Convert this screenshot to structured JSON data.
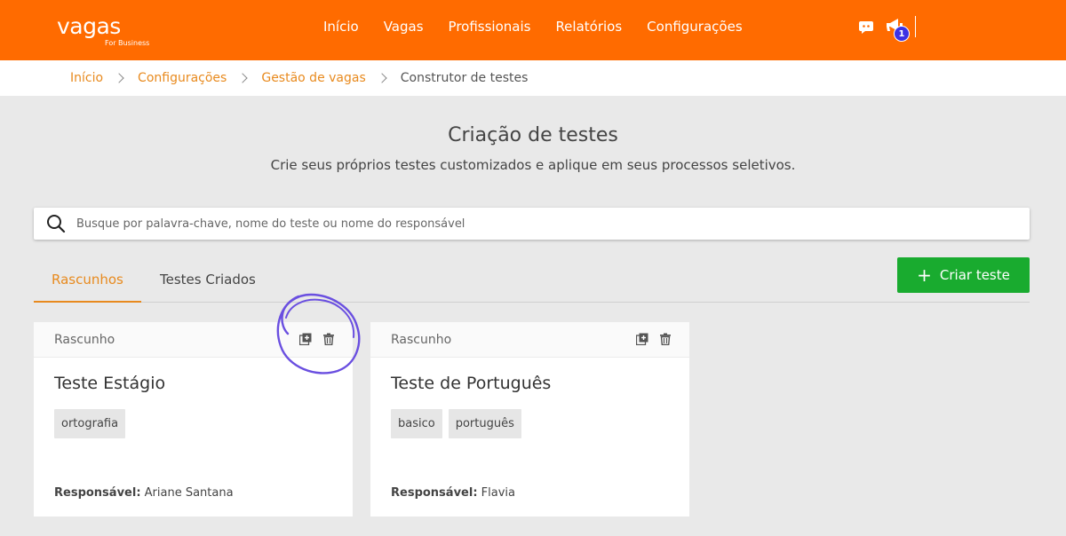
{
  "header": {
    "logo_text": "vagas",
    "logo_sub": "For Business",
    "nav": [
      "Início",
      "Vagas",
      "Profissionais",
      "Relatórios",
      "Configurações"
    ],
    "notification_count": "1",
    "icons": [
      "chat-icon",
      "megaphone-icon"
    ]
  },
  "breadcrumb": {
    "items": [
      "Início",
      "Configurações",
      "Gestão de vagas"
    ],
    "current": "Construtor de testes"
  },
  "page": {
    "title": "Criação de testes",
    "subtitle": "Crie seus próprios testes customizados e aplique em seus processos seletivos."
  },
  "search": {
    "placeholder": "Busque por palavra-chave, nome do teste ou nome do responsável",
    "value": ""
  },
  "tabs": [
    {
      "label": "Rascunhos",
      "active": true
    },
    {
      "label": "Testes Criados",
      "active": false
    }
  ],
  "create_button": "Criar teste",
  "cards": [
    {
      "status": "Rascunho",
      "title": "Teste Estágio",
      "tags": [
        "ortografia"
      ],
      "owner_label": "Responsável:",
      "owner": "Ariane Santana"
    },
    {
      "status": "Rascunho",
      "title": "Teste de Português",
      "tags": [
        "basico",
        "português"
      ],
      "owner_label": "Responsável:",
      "owner": "Flavia"
    }
  ],
  "colors": {
    "brand": "#ff6b00",
    "accent": "#e88a1e",
    "primary_button": "#19ab2f",
    "badge": "#3d32e4",
    "annotation": "#6a4fe0"
  }
}
